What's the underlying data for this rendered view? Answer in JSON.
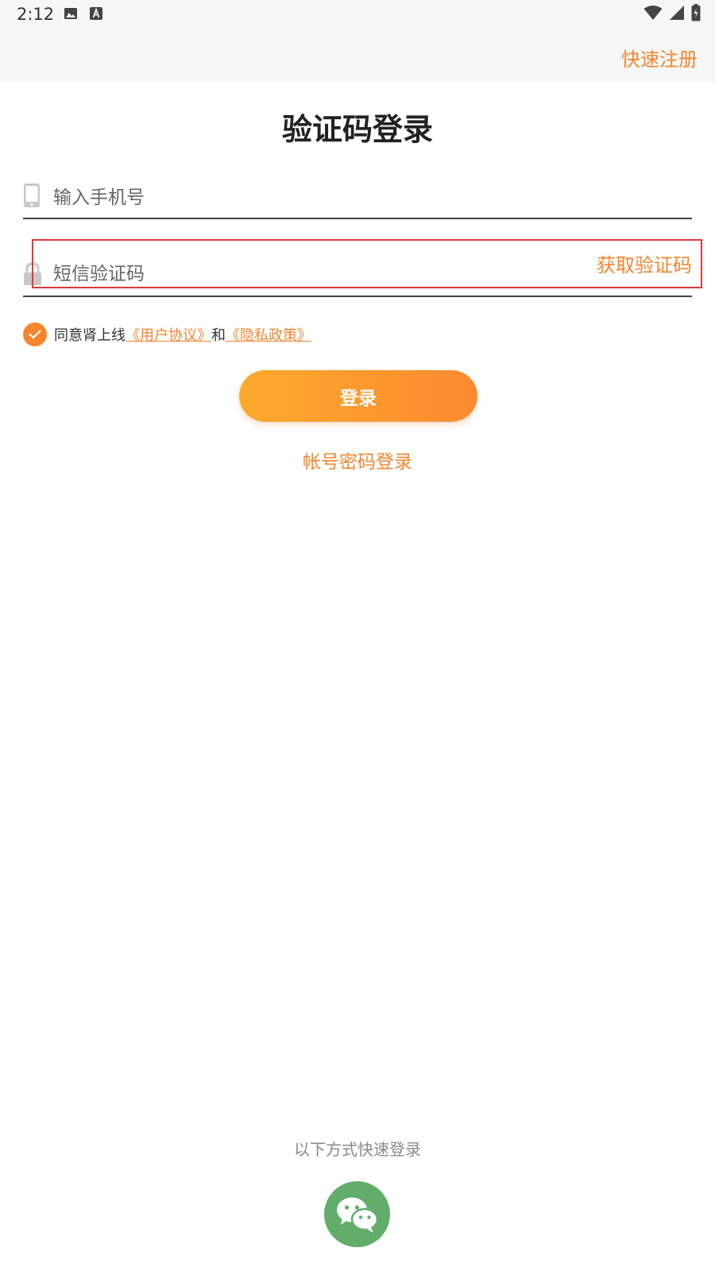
{
  "status_bar": {
    "time": "2:12"
  },
  "header": {
    "register_label": "快速注册"
  },
  "title": "验证码登录",
  "phone_field": {
    "placeholder": "输入手机号",
    "value": ""
  },
  "code_field": {
    "placeholder": "短信验证码",
    "value": "",
    "get_code_label": "获取验证码"
  },
  "agreement": {
    "prefix": "同意肾上线",
    "user_agreement": "《用户协议》",
    "conjunction": "和",
    "privacy_policy": "《隐私政策》",
    "checked": true
  },
  "login_button_label": "登录",
  "password_login_label": "帐号密码登录",
  "quick_login_label": "以下方式快速登录",
  "icons": {
    "phone": "phone-icon",
    "lock": "lock-icon",
    "check": "check-icon",
    "wechat": "wechat-icon"
  },
  "colors": {
    "accent": "#f5852e",
    "button_start": "#fcaa2e",
    "button_end": "#fd8a30",
    "wechat": "#62ad6a",
    "highlight": "#e03a3a"
  }
}
